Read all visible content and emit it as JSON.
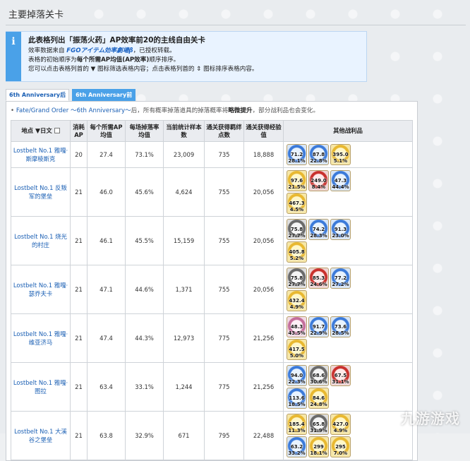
{
  "page_title": "主要掉落关卡",
  "info": {
    "icon": "ℹ",
    "headline": "此表格列出「振荡火药」AP效率前20的主线自由关卡",
    "lines": [
      {
        "pre": "效率数据来自 ",
        "link": "FGOアイテム効率劇場β",
        "post": "，已授权转载。"
      },
      {
        "pre": "表格的初始顺序为",
        "bold": "每个所需AP均值(AP效率)",
        "post": "顺序排序。"
      },
      {
        "pre": "您可以点击表格列首的 ",
        "icon1": "▼",
        "mid": " 图标筛选表格内容；点击表格列首的 ",
        "icon2": "⇕",
        "post": " 图标排序表格内容。"
      }
    ]
  },
  "tabs": [
    "6th Anniversary后",
    "6th Anniversary前"
  ],
  "note": {
    "bullet": "•",
    "link": "Fate/Grand Order ～6th Anniversary～",
    "pre": "后，所有概率掉落道具的掉落概率将",
    "bold": "略微提升",
    "post": "，部分战利品也会变化。"
  },
  "table": {
    "headers": {
      "loc": "地点",
      "filter_icon": "▼",
      "filter_label": "日文",
      "ap": "消耗AP",
      "per_ap": "每个所需AP均值",
      "rate": "每场掉落率均值",
      "samples": "当前统计样本数",
      "bond": "通关获得羁绊点数",
      "exp": "通关获得经验值",
      "items": "其他战利品"
    },
    "rows": [
      {
        "loc": "Lostbelt No.1 雅嘎·斯摩棱斯克",
        "ap": "20",
        "per_ap": "27.4",
        "rate": "73.1%",
        "samples": "23,009",
        "bond": "735",
        "exp": "18,888",
        "items": [
          {
            "c": "c-blue",
            "q": "71.2",
            "p": "28.1%"
          },
          {
            "c": "c-blue",
            "q": "87.8",
            "p": "22.8%"
          },
          {
            "c": "c-gold",
            "q": "395.0",
            "p": "5.1%"
          }
        ]
      },
      {
        "loc": "Lostbelt No.1 反叛军的堡垒",
        "ap": "21",
        "per_ap": "46.0",
        "rate": "45.6%",
        "samples": "4,624",
        "bond": "755",
        "exp": "20,056",
        "items": [
          {
            "c": "c-gold",
            "q": "97.6",
            "p": "21.5%"
          },
          {
            "c": "c-red",
            "q": "249.0",
            "p": "8.4%"
          },
          {
            "c": "c-blue",
            "q": "47.3",
            "p": "44.4%"
          },
          {
            "c": "c-gold",
            "q": "467.3",
            "p": "4.5%"
          }
        ]
      },
      {
        "loc": "Lostbelt No.1 烧光的村庄",
        "ap": "21",
        "per_ap": "46.1",
        "rate": "45.5%",
        "samples": "15,159",
        "bond": "755",
        "exp": "20,056",
        "items": [
          {
            "c": "c-gray",
            "q": "75.8",
            "p": "27.7%"
          },
          {
            "c": "c-blue",
            "q": "74.2",
            "p": "28.3%"
          },
          {
            "c": "c-blue",
            "q": "91.3",
            "p": "23.0%"
          },
          {
            "c": "c-gold",
            "q": "405.8",
            "p": "5.2%"
          }
        ]
      },
      {
        "loc": "Lostbelt No.1 雅嘎·瑟乔夫卡",
        "ap": "21",
        "per_ap": "47.1",
        "rate": "44.6%",
        "samples": "1,371",
        "bond": "755",
        "exp": "20,056",
        "items": [
          {
            "c": "c-gray",
            "q": "75.8",
            "p": "27.7%"
          },
          {
            "c": "c-red",
            "q": "85.3",
            "p": "24.6%"
          },
          {
            "c": "c-blue",
            "q": "77.2",
            "p": "27.2%"
          },
          {
            "c": "c-gold",
            "q": "432.4",
            "p": "4.9%"
          }
        ]
      },
      {
        "loc": "Lostbelt No.1 雅嘎·维亚济马",
        "ap": "21",
        "per_ap": "47.4",
        "rate": "44.3%",
        "samples": "12,973",
        "bond": "775",
        "exp": "21,256",
        "items": [
          {
            "c": "c-pink",
            "q": "48.3",
            "p": "43.5%"
          },
          {
            "c": "c-blue",
            "q": "91.7",
            "p": "22.9%"
          },
          {
            "c": "c-blue",
            "q": "73.6",
            "p": "28.5%"
          },
          {
            "c": "c-gold",
            "q": "417.5",
            "p": "5.0%"
          }
        ]
      },
      {
        "loc": "Lostbelt No.1 雅嘎·图拉",
        "ap": "21",
        "per_ap": "63.4",
        "rate": "33.1%",
        "samples": "1,244",
        "bond": "775",
        "exp": "21,256",
        "items": [
          {
            "c": "c-blue",
            "q": "94.0",
            "p": "22.3%"
          },
          {
            "c": "c-gray",
            "q": "68.6",
            "p": "30.6%"
          },
          {
            "c": "c-red",
            "q": "67.5",
            "p": "31.1%"
          },
          {
            "c": "c-blue",
            "q": "113.6",
            "p": "18.5%"
          },
          {
            "c": "c-gold",
            "q": "84.6",
            "p": "24.8%"
          }
        ]
      },
      {
        "loc": "Lostbelt No.1 大溪谷之堡垒",
        "ap": "21",
        "per_ap": "63.8",
        "rate": "32.9%",
        "samples": "671",
        "bond": "795",
        "exp": "22,488",
        "items": [
          {
            "c": "c-gold",
            "q": "185.4",
            "p": "11.3%"
          },
          {
            "c": "c-gray",
            "q": "65.8",
            "p": "31.9%"
          },
          {
            "c": "c-gold",
            "q": "427.0",
            "p": "4.9%"
          },
          {
            "c": "c-blue",
            "q": "63.2",
            "p": "33.2%"
          },
          {
            "c": "c-gold",
            "q": "299",
            "p": "18.1%"
          },
          {
            "c": "c-gold",
            "q": "295",
            "p": "7.0%"
          }
        ]
      }
    ]
  },
  "watermark": "九游游戏"
}
